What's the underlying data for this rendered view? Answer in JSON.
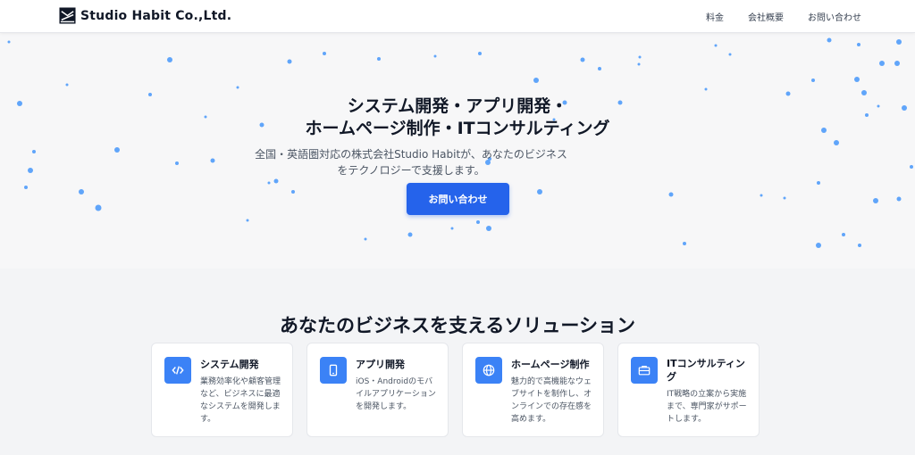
{
  "header": {
    "brand": "Studio Habit Co.,Ltd.",
    "nav": [
      {
        "label": "料金"
      },
      {
        "label": "会社概要"
      },
      {
        "label": "お問い合わせ"
      }
    ]
  },
  "hero": {
    "title_line1": "システム開発・アプリ開発・",
    "title_line2": "ホームページ制作・ITコンサルティング",
    "subtitle": "全国・英語圏対応の株式会社Studio Habitが、あなたのビジネスをテクノロジーで支援します。",
    "cta_label": "お問い合わせ"
  },
  "solutions": {
    "title": "あなたのビジネスを支えるソリューション",
    "cards": [
      {
        "icon": "code-icon",
        "title": "システム開発",
        "description": "業務効率化や顧客管理など、ビジネスに最適なシステムを開発します。"
      },
      {
        "icon": "mobile-icon",
        "title": "アプリ開発",
        "description": "iOS・Androidのモバイルアプリケーションを開発します。"
      },
      {
        "icon": "globe-icon",
        "title": "ホームページ制作",
        "description": "魅力的で高機能なウェブサイトを制作し、オンラインでの存在感を高めます。"
      },
      {
        "icon": "briefcase-icon",
        "title": "ITコンサルティング",
        "description": "IT戦略の立案から実施まで、専門家がサポートします。"
      }
    ]
  },
  "colors": {
    "accent": "#2563eb",
    "icon_bg": "#3b82f6",
    "particle": "#60a5fa"
  }
}
